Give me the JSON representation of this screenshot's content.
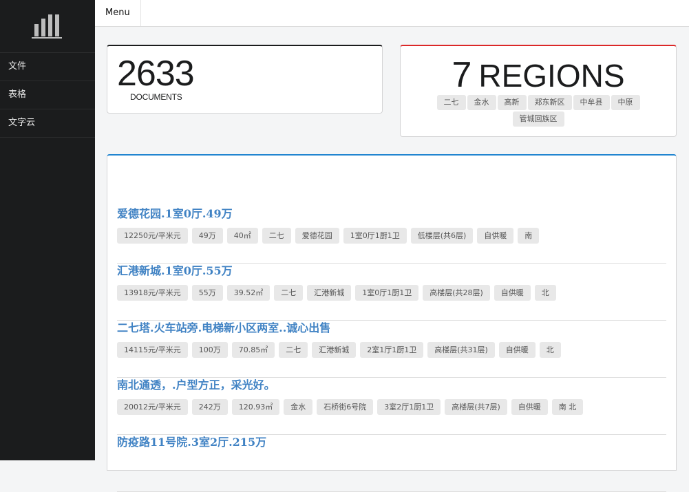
{
  "sidebar": {
    "logo_icon": "bar-chart-icon",
    "items": [
      {
        "label": "文件"
      },
      {
        "label": "表格"
      },
      {
        "label": "文字云"
      }
    ]
  },
  "topbar": {
    "menu_label": "Menu"
  },
  "documents": {
    "count": "2633",
    "label": "DOCUMENTS"
  },
  "regions": {
    "count": "7",
    "label": "REGIONS",
    "tags": [
      "二七",
      "金水",
      "高新",
      "郑东新区",
      "中牟县",
      "中原",
      "管城回族区"
    ]
  },
  "listings": [
    {
      "title": "爱德花园.1室0厅.49万",
      "tags": [
        "12250元/平米元",
        "49万",
        "40㎡",
        "二七",
        "爱德花园",
        "1室0厅1厨1卫",
        "低楼层(共6层)",
        "自供暖",
        "南"
      ]
    },
    {
      "title": "汇港新城.1室0厅.55万",
      "tags": [
        "13918元/平米元",
        "55万",
        "39.52㎡",
        "二七",
        "汇港新城",
        "1室0厅1厨1卫",
        "高楼层(共28层)",
        "自供暖",
        "北"
      ]
    },
    {
      "title": "二七塔.火车站旁.电梯新小区两室..诚心出售",
      "tags": [
        "14115元/平米元",
        "100万",
        "70.85㎡",
        "二七",
        "汇港新城",
        "2室1厅1厨1卫",
        "高楼层(共31层)",
        "自供暖",
        "北"
      ]
    },
    {
      "title": "南北通透，.户型方正，采光好。",
      "tags": [
        "20012元/平米元",
        "242万",
        "120.93㎡",
        "金水",
        "石桥街6号院",
        "3室2厅1厨1卫",
        "高楼层(共7层)",
        "自供暖",
        "南 北"
      ]
    },
    {
      "title": "防疫路11号院.3室2厅.215万",
      "tags": []
    }
  ]
}
